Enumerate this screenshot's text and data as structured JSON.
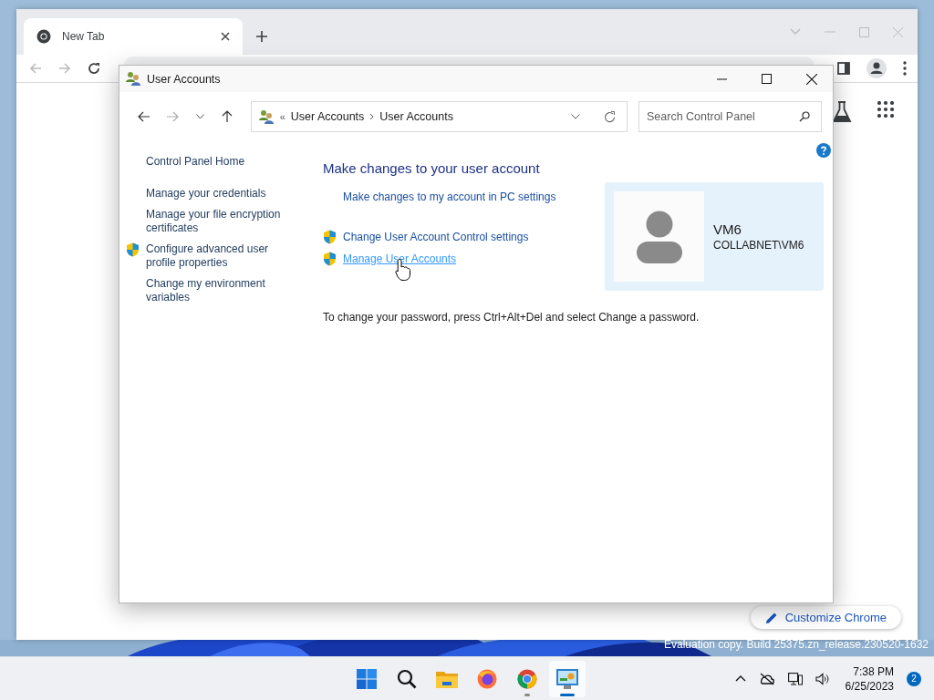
{
  "browser": {
    "tabs": [
      {
        "title": "New Tab",
        "selected": true
      }
    ],
    "customize_button": "Customize Chrome"
  },
  "window": {
    "title": "User Accounts"
  },
  "address_bar": {
    "overflow": "«",
    "breadcrumbs": [
      "User Accounts",
      "User Accounts"
    ]
  },
  "search": {
    "placeholder": "Search Control Panel"
  },
  "sidebar": {
    "items": [
      {
        "label": "Control Panel Home",
        "shield": false
      },
      {
        "label": "Manage your credentials",
        "shield": false
      },
      {
        "label": "Manage your file encryption certificates",
        "shield": false
      },
      {
        "label": "Configure advanced user profile properties",
        "shield": true
      },
      {
        "label": "Change my environment variables",
        "shield": false
      }
    ]
  },
  "heading": "Make changes to your user account",
  "links": [
    {
      "label": "Make changes to my account in PC settings",
      "shield": false,
      "hovered": false
    },
    {
      "label": "Change User Account Control settings",
      "shield": true,
      "hovered": false
    },
    {
      "label": "Manage User Accounts",
      "shield": true,
      "hovered": true
    }
  ],
  "user": {
    "name": "VM6",
    "account": "COLLABNET\\VM6"
  },
  "note": "To change your password, press Ctrl+Alt+Del and select Change a password.",
  "build_info": "Evaluation copy. Build 25375.zn_release.230520-1632",
  "taskbar": {
    "apps": [
      {
        "kind": "start",
        "running": false,
        "active": false
      },
      {
        "kind": "search",
        "running": false,
        "active": false
      },
      {
        "kind": "files",
        "running": false,
        "active": false
      },
      {
        "kind": "firefox",
        "running": false,
        "active": false
      },
      {
        "kind": "chrome",
        "running": true,
        "active": false
      },
      {
        "kind": "control-panel",
        "running": true,
        "active": true
      }
    ],
    "time": "7:38 PM",
    "date": "6/25/2023",
    "notifications": "2"
  }
}
